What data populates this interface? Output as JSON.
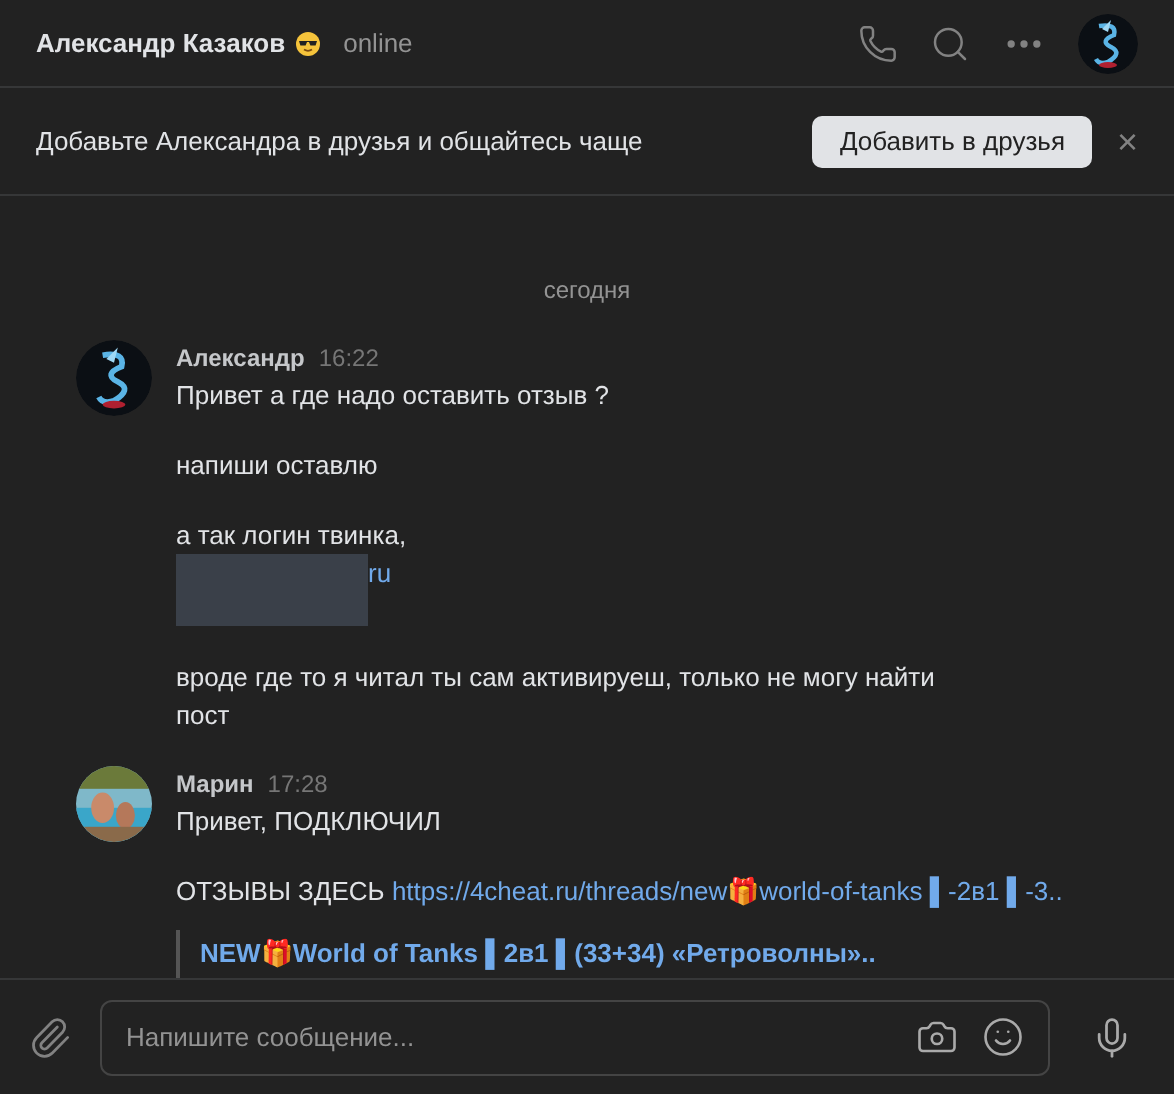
{
  "header": {
    "name": "Александр Казаков",
    "status": "online"
  },
  "banner": {
    "text": "Добавьте Александра в друзья и общайтесь чаще",
    "button": "Добавить в друзья",
    "close": "×"
  },
  "date": "сегодня",
  "messages": [
    {
      "author": "Александр",
      "time": "16:22",
      "items": [
        {
          "kind": "text",
          "text": "Привет а где надо оставить отзыв ?"
        },
        {
          "kind": "text",
          "text": "напиши оставлю"
        },
        {
          "kind": "login",
          "text": "а так логин твинка,",
          "link": "ru"
        },
        {
          "kind": "text",
          "text": "вроде где то я читал ты сам активируеш, только не могу найти пост"
        }
      ]
    },
    {
      "author": "Марин",
      "time": "17:28",
      "items": [
        {
          "kind": "text",
          "text": "Привет, ПОДКЛЮЧИЛ"
        },
        {
          "kind": "link_text",
          "text": "ОТЗЫВЫ ЗДЕСЬ",
          "link": "https://4cheat.ru/threads/new🎁world-of-tanks ▌-2в1 ▌-3.."
        },
        {
          "kind": "preview",
          "text": "NEW🎁World of Tanks ▌2в1 ▌(33+34) «Ретроволны».."
        }
      ]
    }
  ],
  "composer": {
    "placeholder": "Напишите сообщение..."
  }
}
